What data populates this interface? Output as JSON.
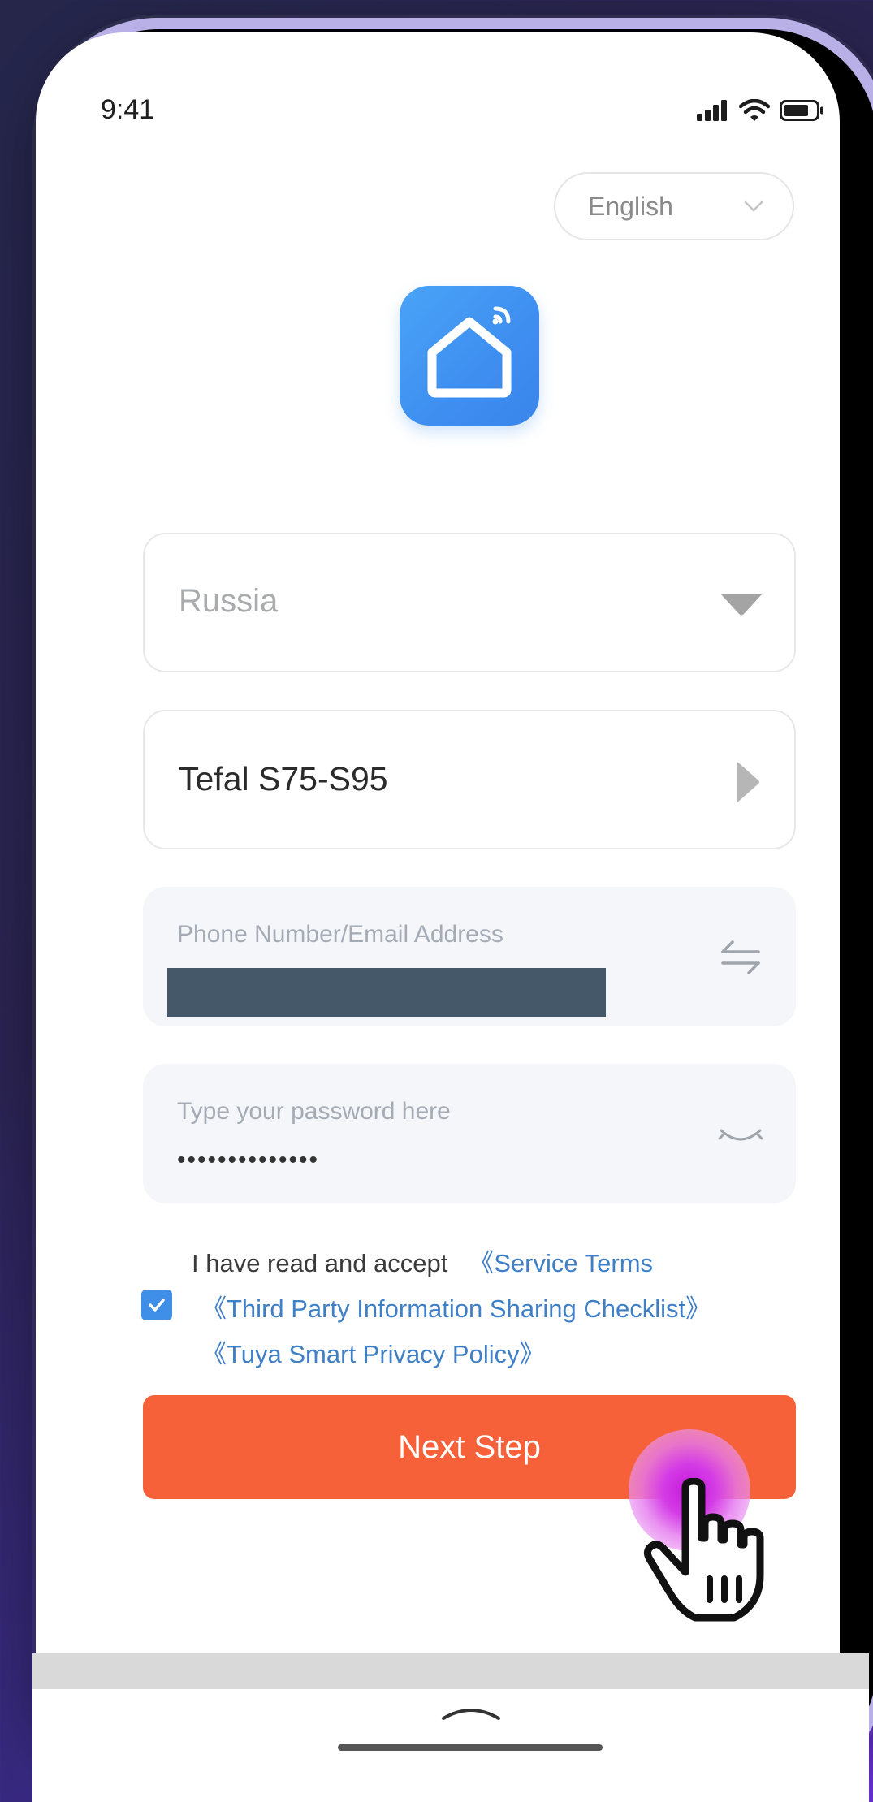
{
  "status_bar": {
    "time": "9:41"
  },
  "language": {
    "selected": "English"
  },
  "form": {
    "country": {
      "value": "Russia"
    },
    "device": {
      "value": "Tefal S75-S95"
    },
    "account": {
      "label": "Phone Number/Email Address"
    },
    "password": {
      "label": "Type your password here",
      "value": "••••••••••••••"
    }
  },
  "agreement": {
    "checked": true,
    "prefix": "I have read and accept",
    "links": [
      "《Service Terms",
      "《Third Party Information Sharing Checklist》",
      "《Tuya Smart Privacy Policy》"
    ]
  },
  "actions": {
    "next_label": "Next Step"
  },
  "colors": {
    "accent": "#f6613a",
    "link": "#3f7fc6",
    "checkbox": "#3f8ee8",
    "logo": "#4aa4f7",
    "redaction": "#445869"
  },
  "icons": {
    "signal": "signal-icon",
    "wifi": "wifi-icon",
    "battery": "battery-icon",
    "app": "smart-home-logo",
    "dropdown": "caret-down-icon",
    "arrow": "caret-right-icon",
    "switch": "switch-arrows-icon",
    "eye": "eye-closed-icon",
    "check": "check-icon",
    "cursor": "hand-pointer-icon",
    "chevron_up": "chevron-up-icon"
  }
}
